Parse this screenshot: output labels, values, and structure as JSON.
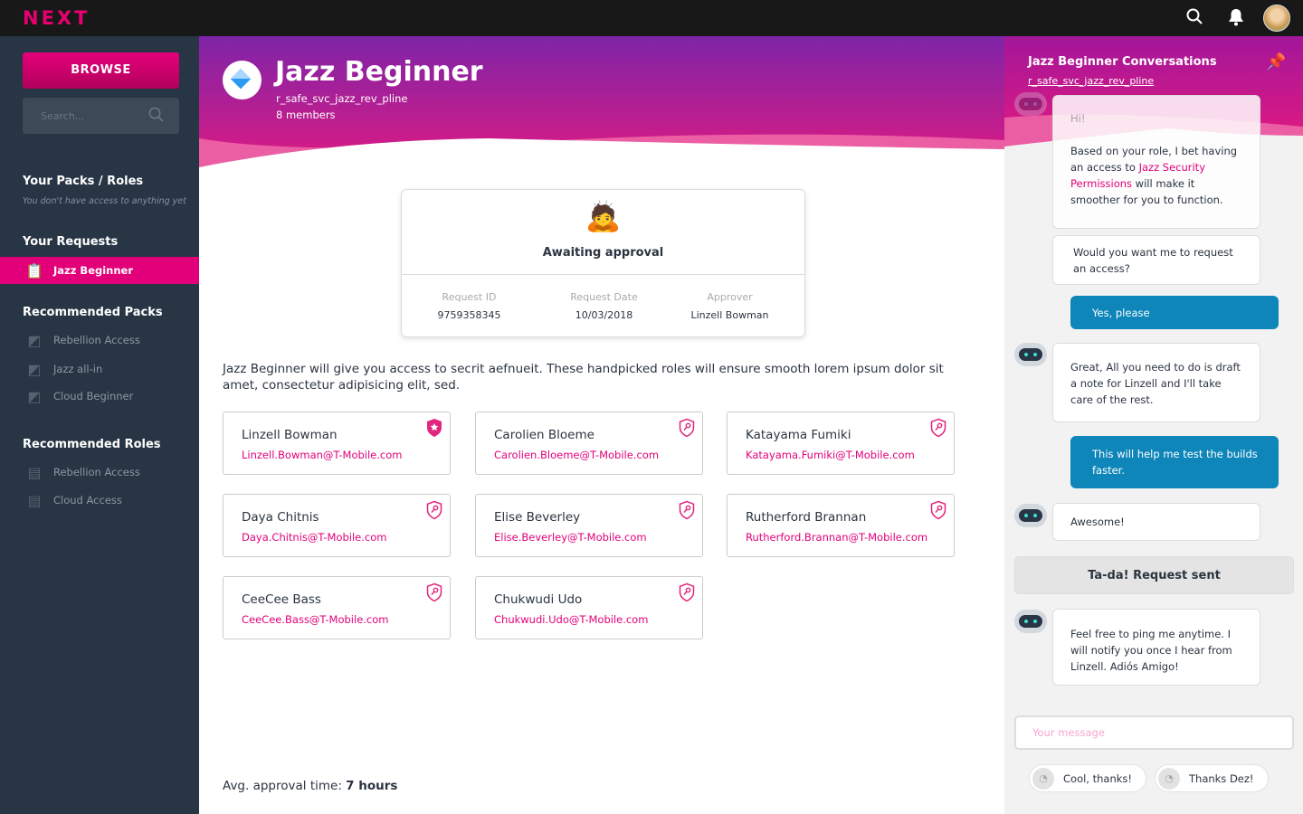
{
  "topbar": {
    "logo": "NEXT",
    "search_icon": "search-icon",
    "bell_icon": "bell-icon"
  },
  "sidebar": {
    "browse": "BROWSE",
    "search_placeholder": "Search...",
    "packs_roles_title": "Your Packs / Roles",
    "packs_roles_empty": "You don't have access to anything yet",
    "requests_title": "Your Requests",
    "requests": [
      {
        "label": "Jazz Beginner",
        "active": true
      }
    ],
    "rec_packs_title": "Recommended Packs",
    "rec_packs": [
      {
        "label": "Rebellion Access"
      },
      {
        "label": "Jazz all-in"
      },
      {
        "label": "Cloud Beginner"
      }
    ],
    "rec_roles_title": "Recommended Roles",
    "rec_roles": [
      {
        "label": "Rebellion Access"
      },
      {
        "label": "Cloud Access"
      }
    ]
  },
  "main": {
    "title": "Jazz Beginner",
    "id": "r_safe_svc_jazz_rev_pline",
    "members": "8 members",
    "status": {
      "emoji": "🙇",
      "label": "Awaiting approval",
      "meta": [
        {
          "label": "Request ID",
          "value": "9759358345"
        },
        {
          "label": "Request Date",
          "value": "10/03/2018"
        },
        {
          "label": "Approver",
          "value": "Linzell Bowman"
        }
      ]
    },
    "description": "Jazz Beginner will give you access to secrit aefnueit. These handpicked roles will ensure smooth lorem ipsum dolor sit amet, consectetur adipisicing elit, sed.",
    "people": [
      {
        "name": "Linzell Bowman",
        "email": "Linzell.Bowman@T-Mobile.com",
        "icon": "shield-star-icon"
      },
      {
        "name": "Carolien Bloeme",
        "email": "Carolien.Bloeme@T-Mobile.com",
        "icon": "shield-key-icon"
      },
      {
        "name": "Katayama Fumiki",
        "email": "Katayama.Fumiki@T-Mobile.com",
        "icon": "shield-key-icon"
      },
      {
        "name": "Daya Chitnis",
        "email": "Daya.Chitnis@T-Mobile.com",
        "icon": "shield-key-icon"
      },
      {
        "name": "Elise Beverley",
        "email": "Elise.Beverley@T-Mobile.com",
        "icon": "shield-key-icon"
      },
      {
        "name": "Rutherford Brannan",
        "email": "Rutherford.Brannan@T-Mobile.com",
        "icon": "shield-key-icon"
      },
      {
        "name": "CeeCee Bass",
        "email": "CeeCee.Bass@T-Mobile.com",
        "icon": "shield-key-icon"
      },
      {
        "name": "Chukwudi Udo",
        "email": "Chukwudi.Udo@T-Mobile.com",
        "icon": "shield-key-icon"
      }
    ],
    "avg_label": "Avg. approval time: ",
    "avg_value": "7 hours"
  },
  "chat": {
    "title": "Jazz Beginner Conversations",
    "link": "r_safe_svc_jazz_rev_pline",
    "m1_hi": "Hi!",
    "m1_a": "Based on your role, I bet having an access to ",
    "m1_link": "Jazz Security Permissions",
    "m1_b": " will make it smoother for you to function.",
    "m2": "Would you want me to request an access?",
    "m3": "Yes, please",
    "m4": "Great, All you need to do is draft a note for Linzell and I'll take care of the rest.",
    "m5": "This will help me test the builds faster.",
    "m6": "Awesome!",
    "tada": "Ta-da! Request sent",
    "m7": "Feel free to ping me anytime. I will notify you once I hear from Linzell. Adiós Amigo!",
    "placeholder": "Your message",
    "chips": [
      "Cool, thanks!",
      "Thanks Dez!"
    ]
  },
  "colors": {
    "accent": "#e2007a",
    "sidebar": "#283544",
    "user_bubble": "#0e86b9"
  }
}
